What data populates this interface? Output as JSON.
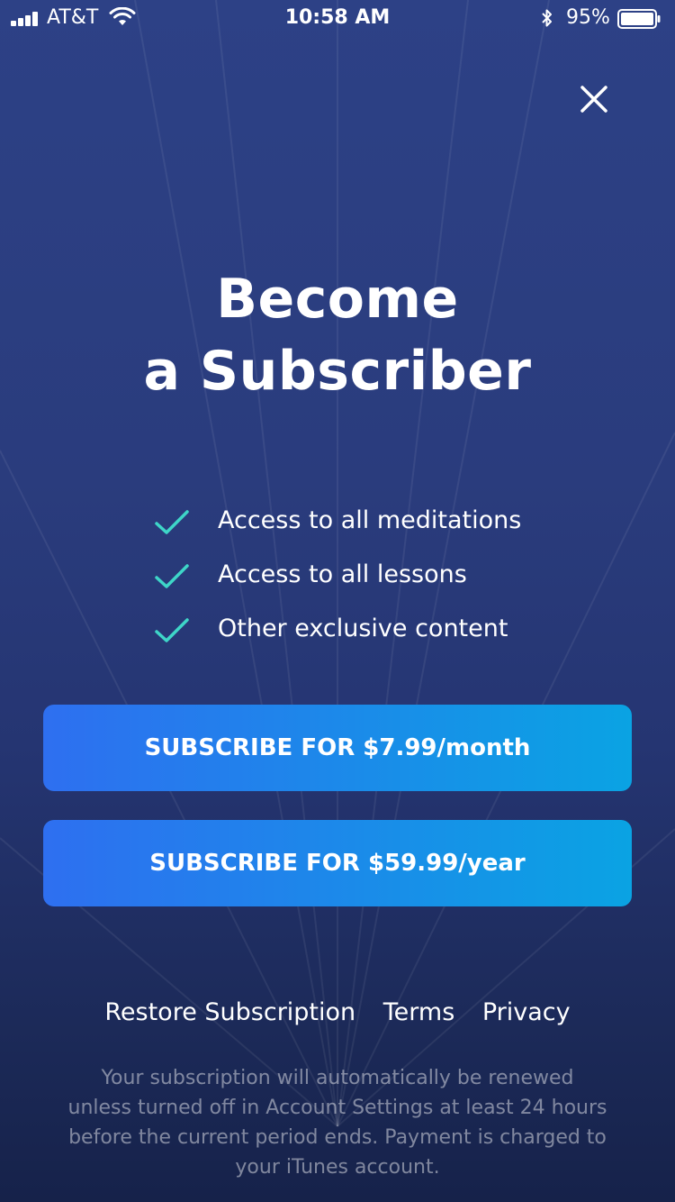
{
  "status_bar": {
    "carrier": "AT&T",
    "time": "10:58 AM",
    "battery_percent": "95%",
    "icons": [
      "signal-icon",
      "wifi-icon",
      "bluetooth-icon",
      "battery-icon"
    ]
  },
  "header": {
    "close_icon": "close-icon"
  },
  "title": {
    "line1": "Become",
    "line2": "a Subscriber"
  },
  "features": [
    {
      "icon": "check-icon",
      "label": "Access to all meditations"
    },
    {
      "icon": "check-icon",
      "label": "Access to all lessons"
    },
    {
      "icon": "check-icon",
      "label": "Other exclusive content"
    }
  ],
  "buttons": {
    "monthly": "SUBSCRIBE FOR $7.99/month",
    "yearly": "SUBSCRIBE FOR $59.99/year"
  },
  "links": {
    "restore": "Restore Subscription",
    "terms": "Terms",
    "privacy": "Privacy"
  },
  "disclaimer": "Your subscription will automatically be renewed unless turned off in Account Settings at least 24 hours before the current period ends. Payment is charged to your iTunes account.",
  "colors": {
    "background_top": "#2d4186",
    "background_bottom": "#16224a",
    "check": "#3ed6c8",
    "button_start": "#2e6ff0",
    "button_end": "#0aa3e3"
  }
}
